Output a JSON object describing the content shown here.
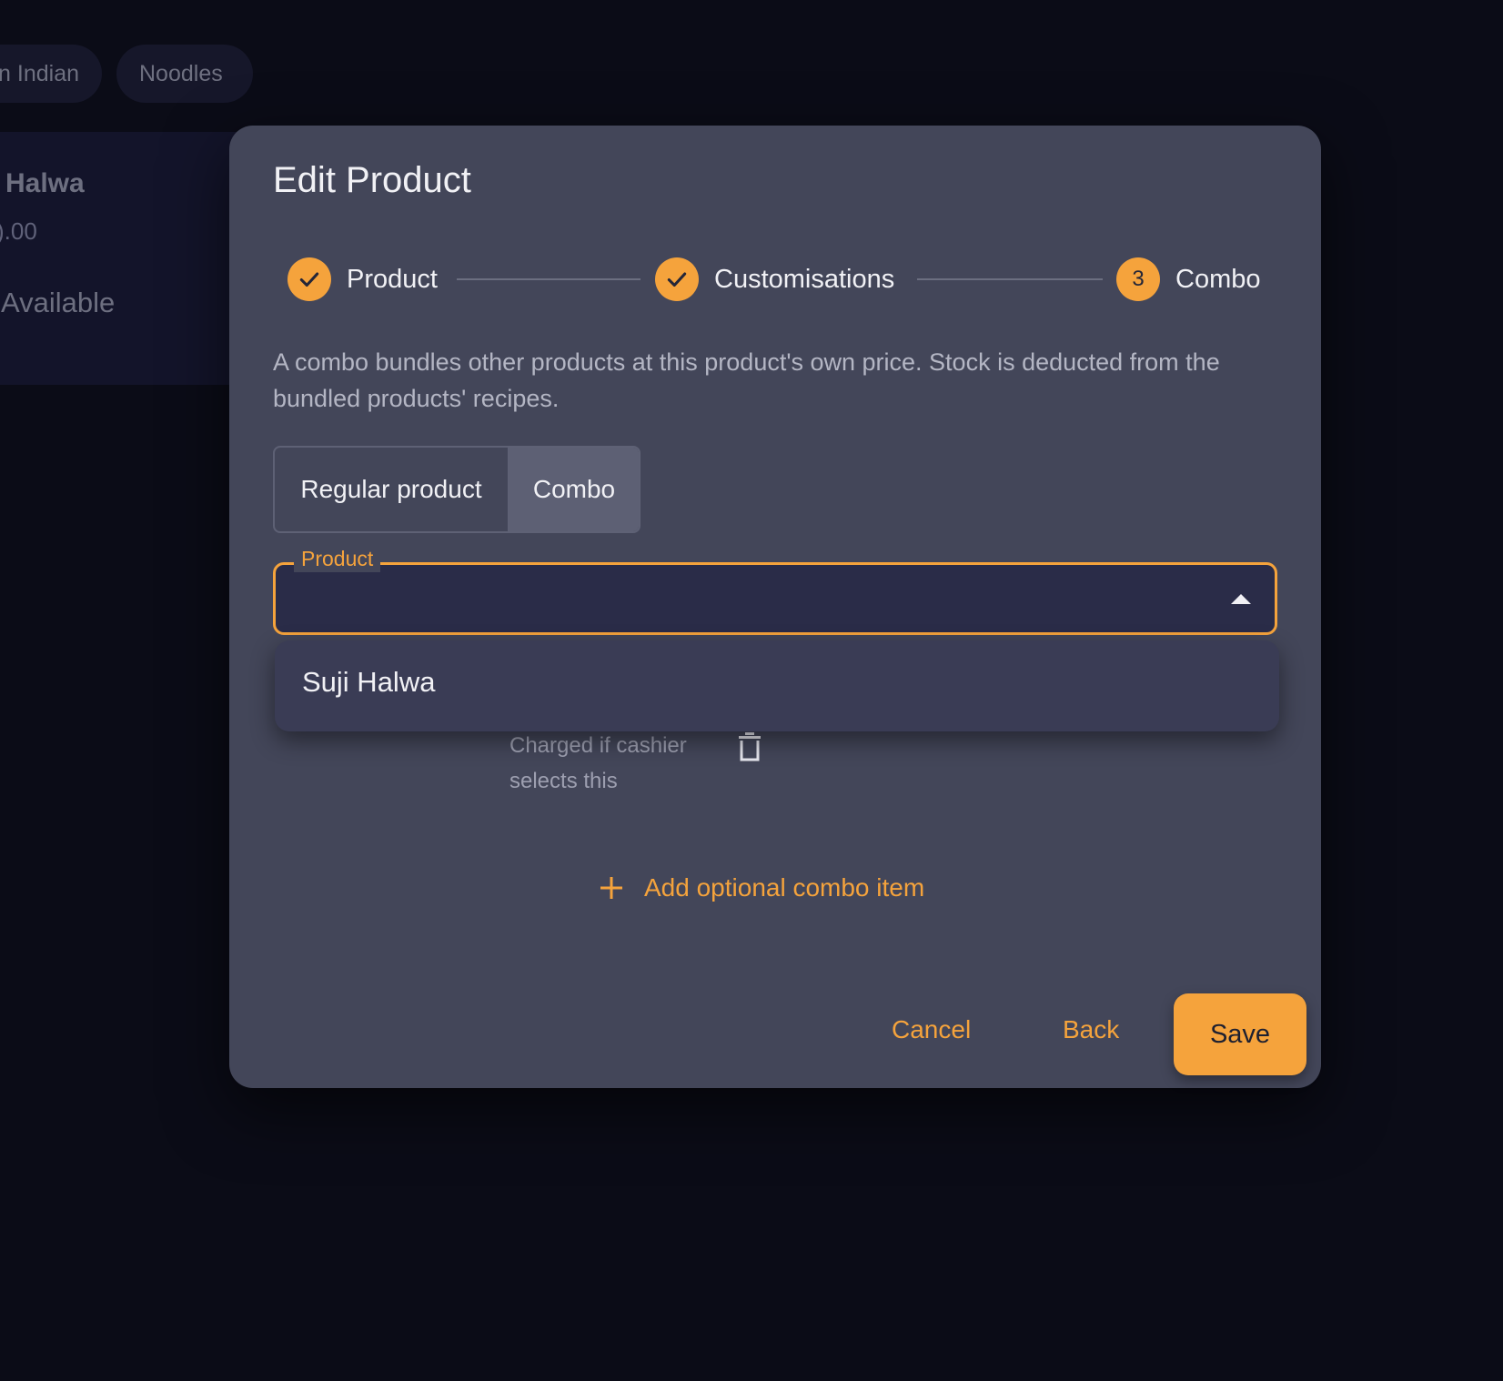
{
  "background": {
    "chips": [
      "n Indian",
      "Noodles"
    ],
    "card": {
      "title": "Halwa",
      "price": ").00",
      "status": "Available"
    }
  },
  "dialog": {
    "title": "Edit Product",
    "steps": [
      {
        "label": "Product",
        "state": "complete",
        "icon": "check-icon"
      },
      {
        "label": "Customisations",
        "state": "complete",
        "icon": "check-icon"
      },
      {
        "label": "Combo",
        "state": "active",
        "number": "3"
      }
    ],
    "description": "A combo bundles other products at this product's own price. Stock is deducted from the bundled products' recipes.",
    "product_type": {
      "options": [
        "Regular product",
        "Combo"
      ],
      "selected": "Combo"
    },
    "product_select": {
      "label": "Product",
      "value": "",
      "open": true,
      "options": [
        "Suji Halwa"
      ]
    },
    "combo_item": {
      "helper_text": "Charged if cashier selects this",
      "delete_icon": "trash-icon"
    },
    "add_optional_label": "Add optional combo item",
    "actions": {
      "cancel": "Cancel",
      "back": "Back",
      "save": "Save"
    }
  },
  "colors": {
    "accent": "#f5a33c",
    "dialog_bg": "#434659",
    "page_bg": "#0b0c17",
    "select_bg": "#2a2c48",
    "menu_bg": "#3a3c55"
  }
}
